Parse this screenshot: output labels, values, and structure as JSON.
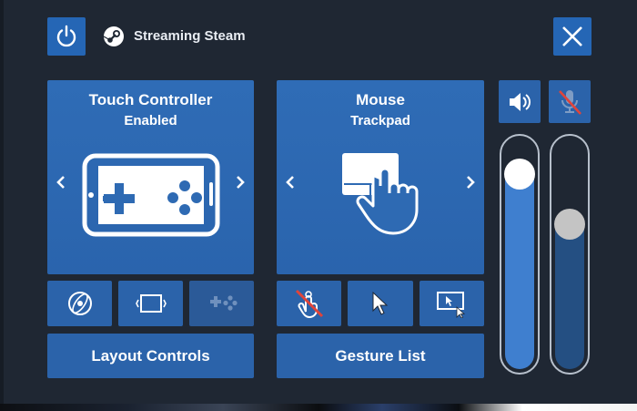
{
  "header": {
    "title": "Streaming Steam",
    "power_icon": "power-icon",
    "steam_icon": "steam-logo-icon",
    "close_icon": "close-icon"
  },
  "touch_card": {
    "title": "Touch Controller",
    "status": "Enabled",
    "illustration_icon": "gamepad-tablet-icon"
  },
  "mouse_card": {
    "title": "Mouse",
    "mode": "Trackpad",
    "illustration_icon": "trackpad-hand-icon"
  },
  "touch_buttons": [
    "gyro-icon",
    "screen-fit-icon",
    "gamepad-dim-icon"
  ],
  "mouse_buttons": [
    "touch-disabled-icon",
    "cursor-icon",
    "cursor-screen-icon"
  ],
  "buttons": {
    "layout_controls": "Layout Controls",
    "gesture_list": "Gesture List"
  },
  "audio": {
    "speaker_icon": "speaker-icon",
    "mic_muted_icon": "mic-muted-icon",
    "speaker_level": 0.9,
    "mic_level": 0.65
  },
  "colors": {
    "background": "#1f2733",
    "accent": "#2566b5",
    "card": "#2f6cb6",
    "mute_red": "#e0443a",
    "slider_fill_active": "#3f7fcf",
    "slider_fill_muted": "#244f82"
  }
}
